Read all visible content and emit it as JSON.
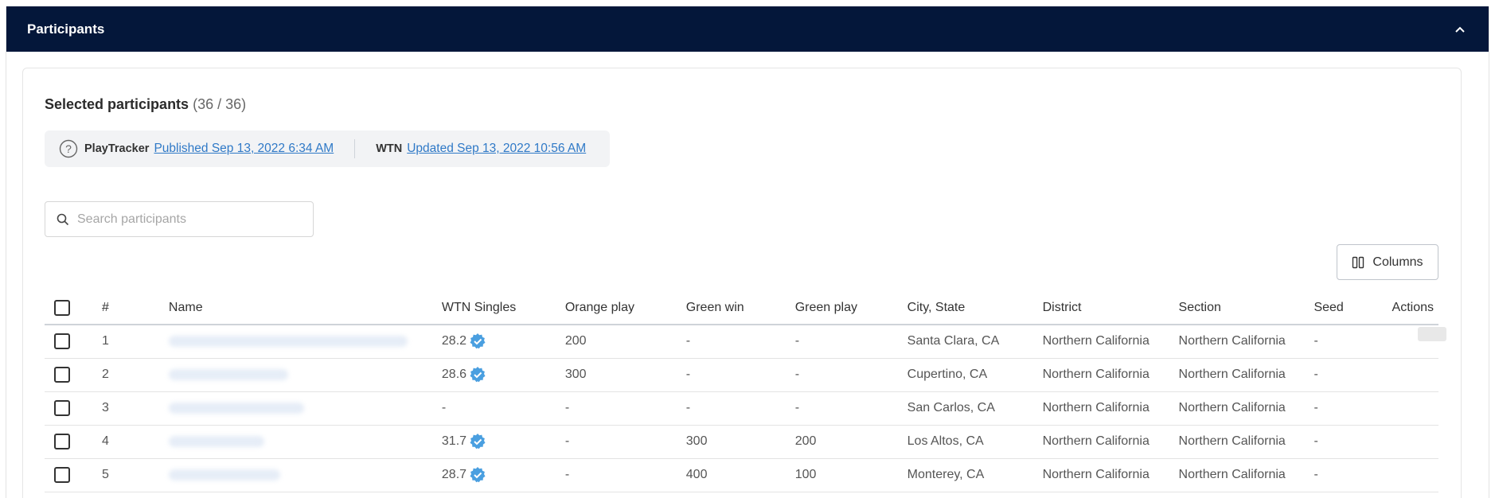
{
  "panel": {
    "title": "Participants"
  },
  "selection": {
    "label": "Selected participants",
    "count": "(36 / 36)"
  },
  "info": {
    "playtracker_label": "PlayTracker",
    "playtracker_link": "Published Sep 13, 2022 6:34 AM",
    "wtn_label": "WTN",
    "wtn_link": "Updated Sep 13, 2022 10:56 AM"
  },
  "search": {
    "placeholder": "Search participants"
  },
  "columns_button": "Columns",
  "table": {
    "headers": [
      "#",
      "Name",
      "WTN Singles",
      "Orange play",
      "Green win",
      "Green play",
      "City, State",
      "District",
      "Section",
      "Seed",
      "Actions"
    ],
    "rows": [
      {
        "num": "1",
        "wtn": "28.2",
        "verified": true,
        "orange": "200",
        "gwin": "-",
        "gplay": "-",
        "city": "Santa Clara, CA",
        "district": "Northern California",
        "section": "Northern California",
        "seed": "-"
      },
      {
        "num": "2",
        "wtn": "28.6",
        "verified": true,
        "orange": "300",
        "gwin": "-",
        "gplay": "-",
        "city": "Cupertino, CA",
        "district": "Northern California",
        "section": "Northern California",
        "seed": "-"
      },
      {
        "num": "3",
        "wtn": "-",
        "verified": false,
        "orange": "-",
        "gwin": "-",
        "gplay": "-",
        "city": "San Carlos, CA",
        "district": "Northern California",
        "section": "Northern California",
        "seed": "-"
      },
      {
        "num": "4",
        "wtn": "31.7",
        "verified": true,
        "orange": "-",
        "gwin": "300",
        "gplay": "200",
        "city": "Los Altos, CA",
        "district": "Northern California",
        "section": "Northern California",
        "seed": "-"
      },
      {
        "num": "5",
        "wtn": "28.7",
        "verified": true,
        "orange": "-",
        "gwin": "400",
        "gplay": "100",
        "city": "Monterey, CA",
        "district": "Northern California",
        "section": "Northern California",
        "seed": "-"
      }
    ]
  },
  "colors": {
    "header_bg": "#04173a",
    "link": "#2f79c7",
    "verified": "#4a9fe0"
  },
  "icons": {
    "collapse": "chevron-up-icon",
    "help": "question-circle-icon",
    "search": "search-icon",
    "columns": "columns-icon",
    "verified": "verified-badge-icon"
  }
}
